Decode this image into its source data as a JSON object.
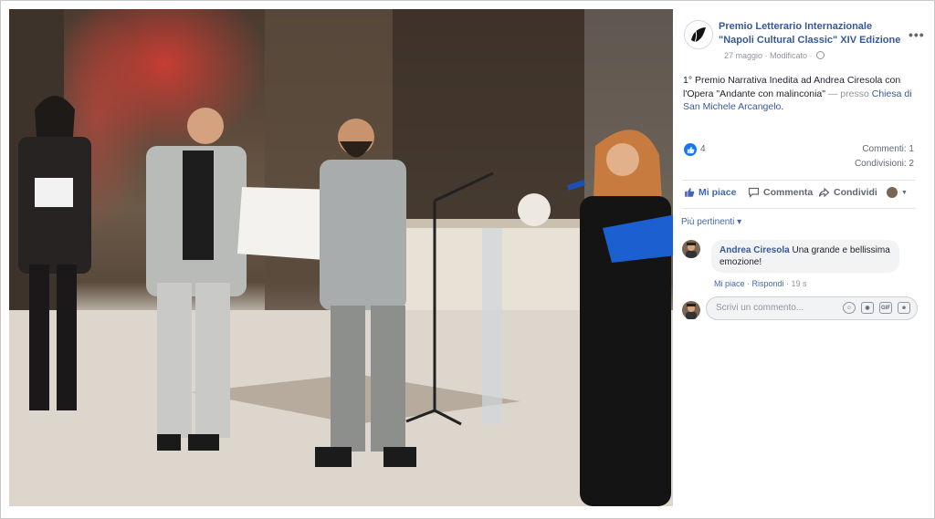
{
  "post": {
    "page_name": "Premio Letterario Internazionale \"Napoli Cultural Classic\" XIV Edizione",
    "meta": "27 maggio · Modificato ·",
    "text_main": "1° Premio Narrativa Inedita ad Andrea Ciresola con l'Opera \"Andante con malinconia\"",
    "text_presso": " — presso ",
    "text_place": "Chiesa di San Michele Arcangelo",
    "text_end": ".",
    "more_label": "•••"
  },
  "stats": {
    "likes": "4",
    "comments": "Commenti: 1",
    "shares": "Condivisioni: 2"
  },
  "actions": {
    "like": "Mi piace",
    "comment": "Commenta",
    "share": "Condividi"
  },
  "filter": {
    "label": "Più pertinenti ▾"
  },
  "comment": {
    "author": "Andrea Ciresola",
    "text": " Una grande e bellissima emozione!",
    "like": "Mi piace",
    "sep": " · ",
    "reply": "Rispondi",
    "time": " · 19 s"
  },
  "composer": {
    "placeholder": "Scrivi un commento...",
    "icons": [
      "emoji-icon",
      "camera-icon",
      "gif-icon",
      "sticker-icon"
    ],
    "gif_label": "GIF"
  },
  "colors": {
    "link": "#365899",
    "accent": "#4267b2",
    "muted": "#90949c",
    "like_blue": "#1877f2"
  }
}
